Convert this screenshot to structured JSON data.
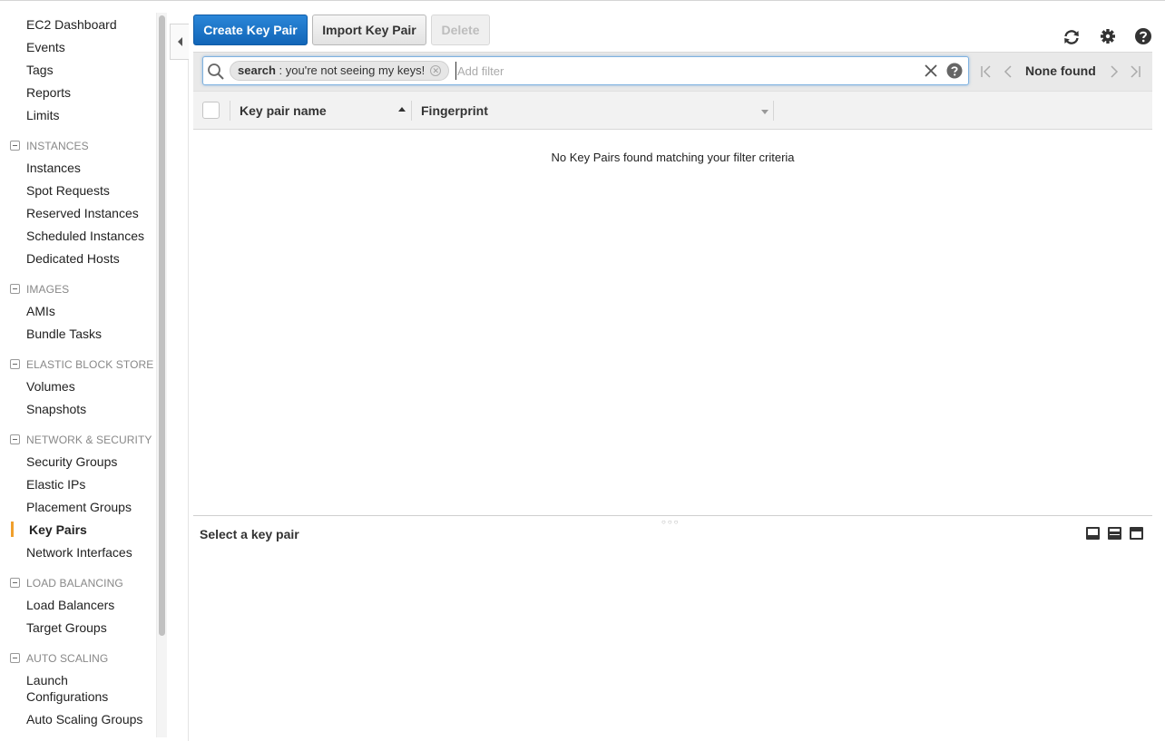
{
  "sidebar": {
    "top_items": [
      "EC2 Dashboard",
      "Events",
      "Tags",
      "Reports",
      "Limits"
    ],
    "sections": [
      {
        "header": "INSTANCES",
        "items": [
          "Instances",
          "Spot Requests",
          "Reserved Instances",
          "Scheduled Instances",
          "Dedicated Hosts"
        ]
      },
      {
        "header": "IMAGES",
        "items": [
          "AMIs",
          "Bundle Tasks"
        ]
      },
      {
        "header": "ELASTIC BLOCK STORE",
        "items": [
          "Volumes",
          "Snapshots"
        ]
      },
      {
        "header": "NETWORK & SECURITY",
        "items": [
          "Security Groups",
          "Elastic IPs",
          "Placement Groups",
          "Key Pairs",
          "Network Interfaces"
        ]
      },
      {
        "header": "LOAD BALANCING",
        "items": [
          "Load Balancers",
          "Target Groups"
        ]
      },
      {
        "header": "AUTO SCALING",
        "items": [
          "Launch",
          "Configurations",
          "Auto Scaling Groups"
        ]
      }
    ],
    "active_item": "Key Pairs",
    "accent_color": "#f0a02d"
  },
  "toolbar": {
    "create_label": "Create Key Pair",
    "import_label": "Import Key Pair",
    "delete_label": "Delete",
    "icons": [
      "refresh-icon",
      "gear-icon",
      "help-icon"
    ],
    "primary_color": "#1a70c2"
  },
  "filter": {
    "token_key": "search",
    "token_value": " : you're not seeing my keys!",
    "placeholder": "Add filter",
    "pager_text": "None found"
  },
  "table": {
    "columns": [
      "Key pair name",
      "Fingerprint"
    ],
    "empty_message": "No Key Pairs found matching your filter criteria"
  },
  "detail": {
    "title": "Select a key pair"
  }
}
